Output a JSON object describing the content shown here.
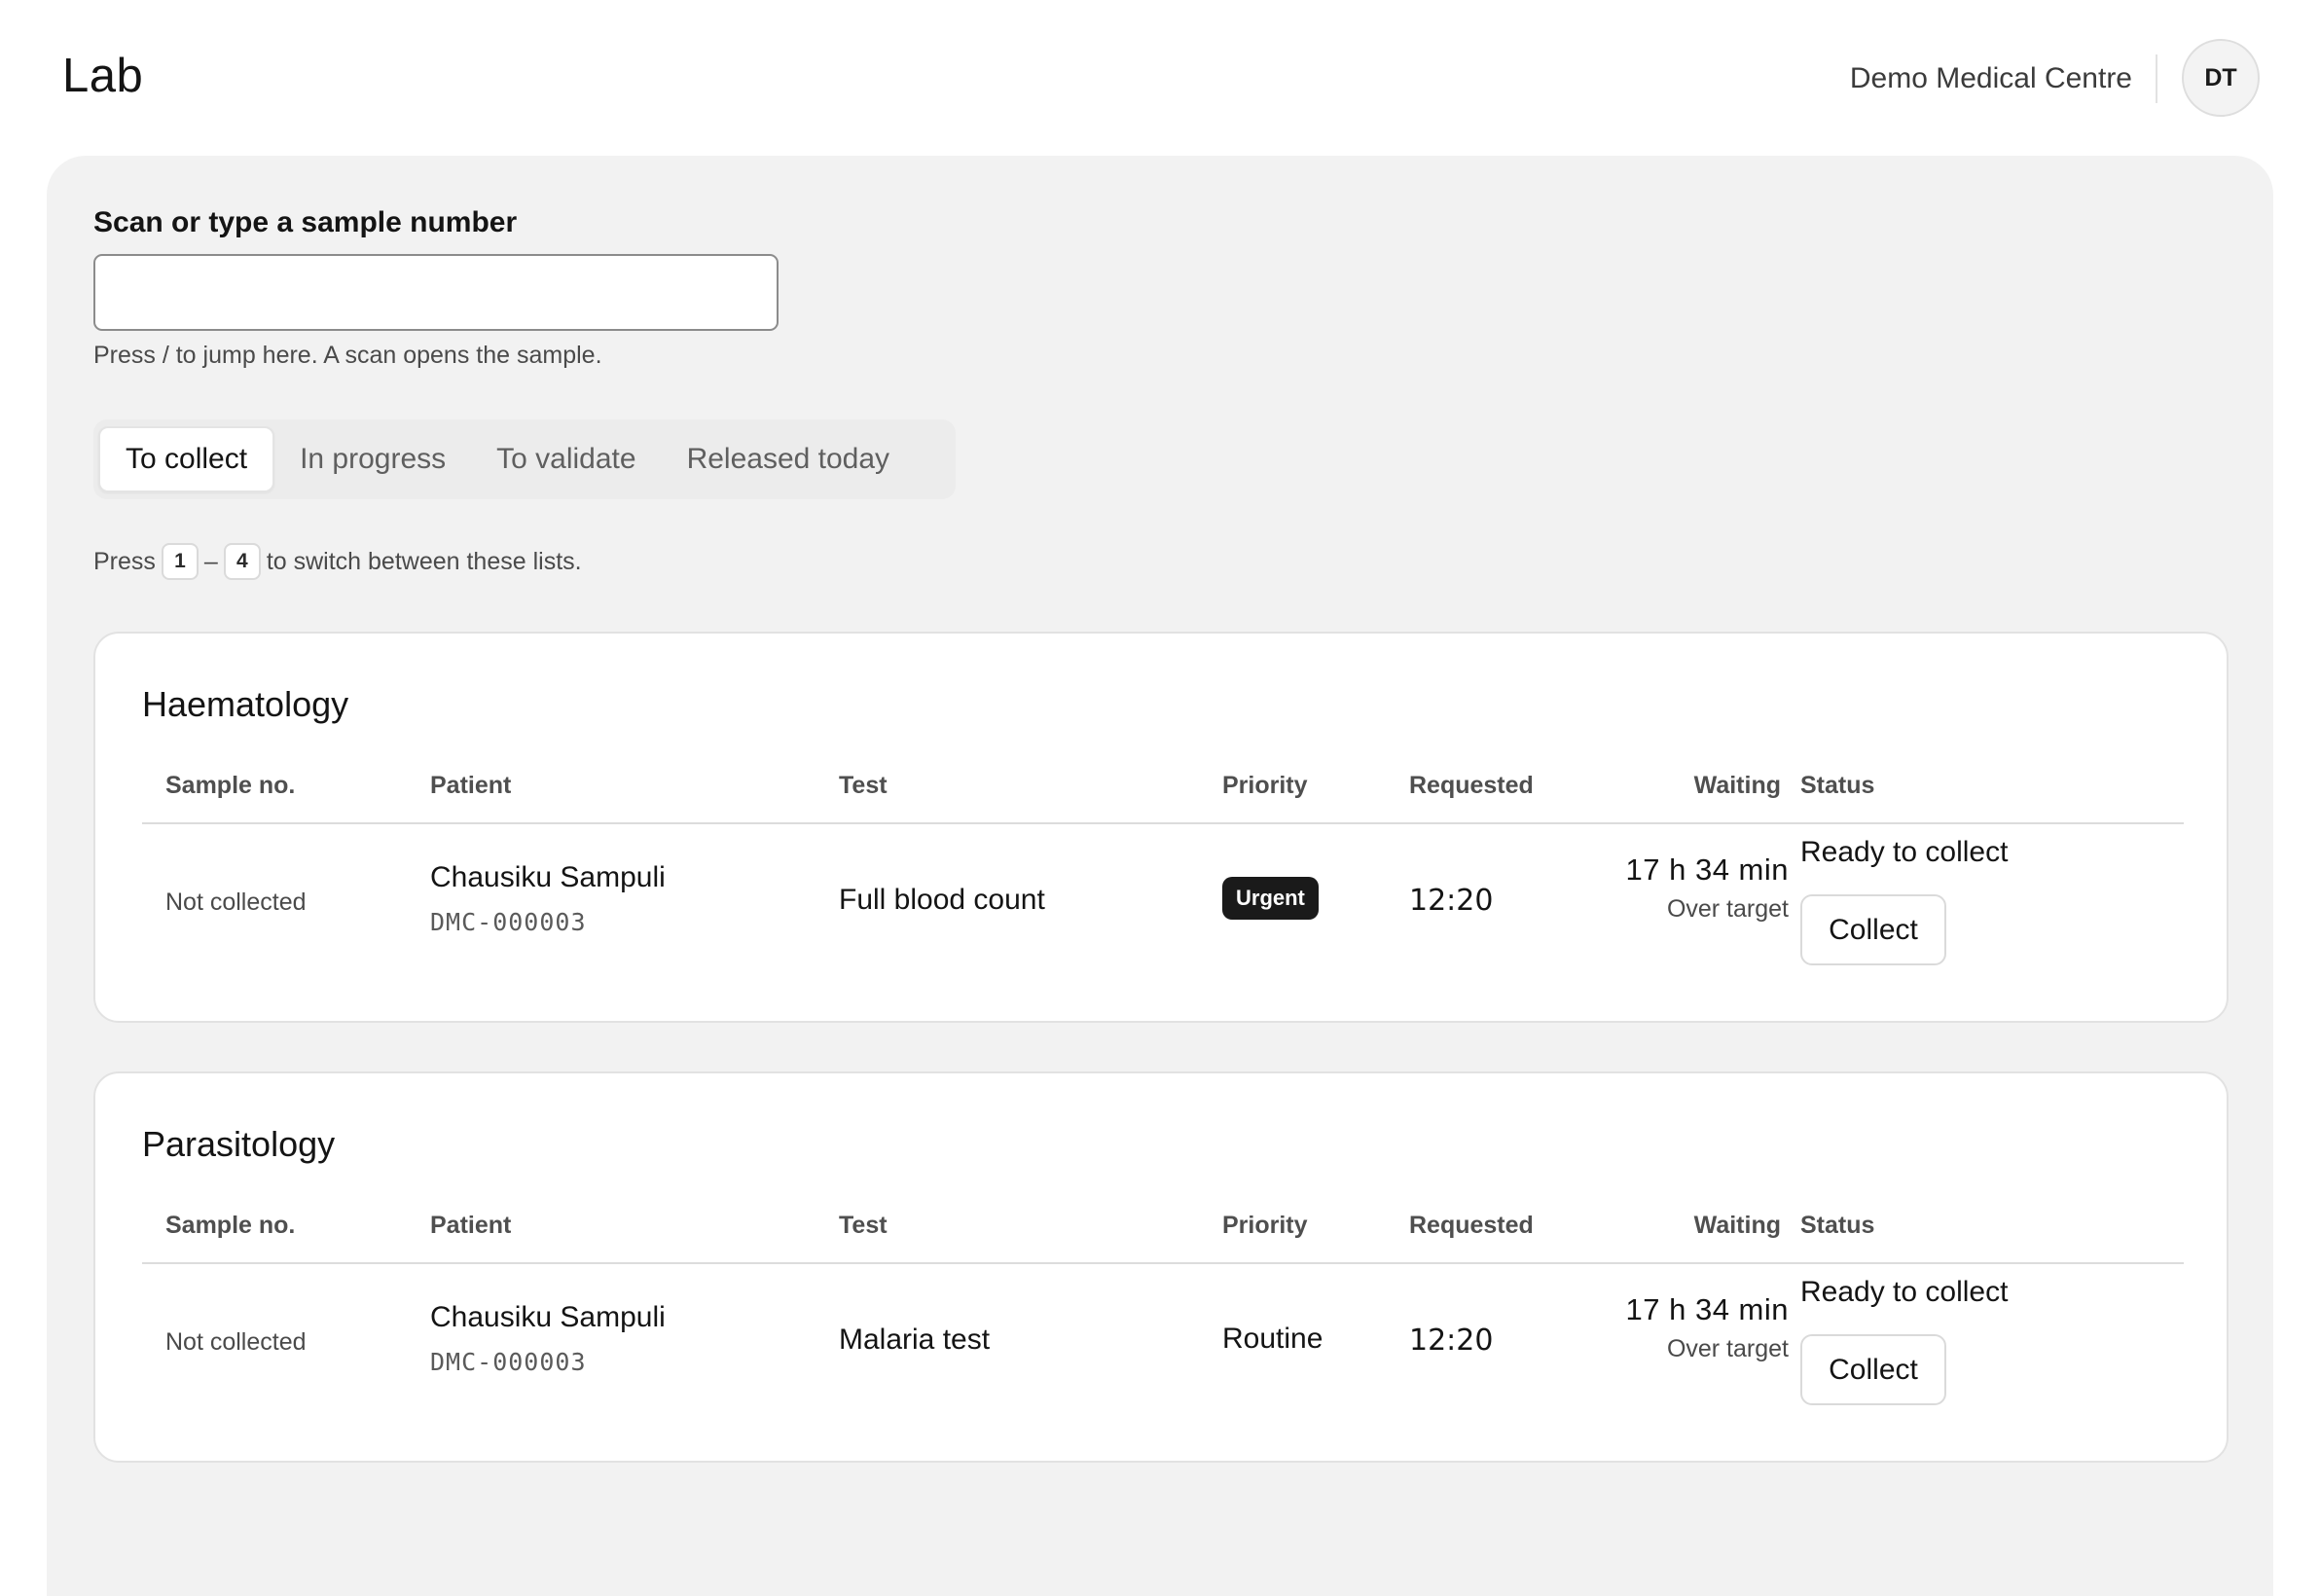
{
  "header": {
    "title": "Lab",
    "organization": "Demo Medical Centre",
    "avatar_initials": "DT"
  },
  "scan": {
    "label": "Scan or type a sample number",
    "value": "",
    "placeholder": "",
    "hint": "Press / to jump here. A scan opens the sample."
  },
  "tabs": [
    {
      "label": "To collect",
      "active": true
    },
    {
      "label": "In progress",
      "active": false
    },
    {
      "label": "To validate",
      "active": false
    },
    {
      "label": "Released today",
      "active": false
    }
  ],
  "switch_hint": {
    "prefix": "Press",
    "key_start": "1",
    "dash": "–",
    "key_end": "4",
    "suffix": "to switch between these lists."
  },
  "columns": {
    "sample_no": "Sample no.",
    "patient": "Patient",
    "test": "Test",
    "priority": "Priority",
    "requested": "Requested",
    "waiting": "Waiting",
    "status": "Status"
  },
  "sections": [
    {
      "title": "Haematology",
      "rows": [
        {
          "sample_no": "Not collected",
          "patient_name": "Chausiku Sampuli",
          "patient_id": "DMC-000003",
          "test": "Full blood count",
          "priority": "Urgent",
          "priority_style": "badge",
          "requested": "12:20",
          "waiting": "17 h 34 min",
          "waiting_note": "Over target",
          "status": "Ready to collect",
          "action": "Collect"
        }
      ]
    },
    {
      "title": "Parasitology",
      "rows": [
        {
          "sample_no": "Not collected",
          "patient_name": "Chausiku Sampuli",
          "patient_id": "DMC-000003",
          "test": "Malaria test",
          "priority": "Routine",
          "priority_style": "text",
          "requested": "12:20",
          "waiting": "17 h 34 min",
          "waiting_note": "Over target",
          "status": "Ready to collect",
          "action": "Collect"
        }
      ]
    }
  ]
}
